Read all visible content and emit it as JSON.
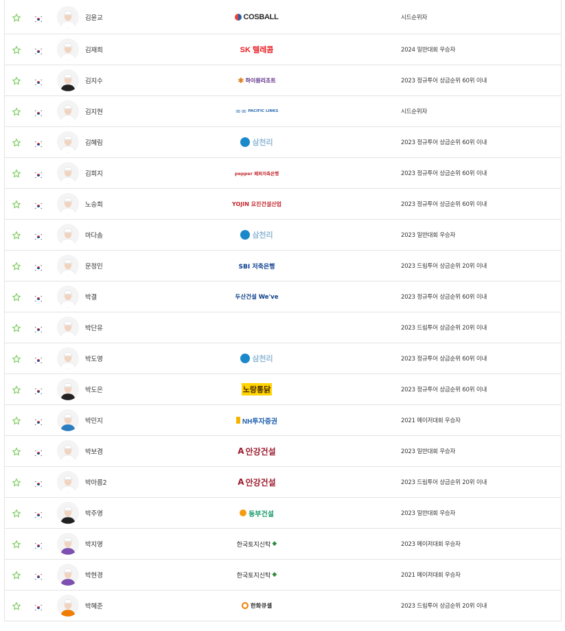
{
  "colors": {
    "star_outline": "#7acb5b",
    "row_divider": "#e3e3e3",
    "flag_red": "#cd2e3a",
    "flag_blue": "#0047a0"
  },
  "players": [
    {
      "name": "김윤교",
      "sponsor": "COSBALL",
      "sponsor_style": "cosball",
      "qualification": "시드순위자"
    },
    {
      "name": "김재희",
      "sponsor": "SK 텔레콤",
      "sponsor_style": "sk",
      "qualification": "2024 일반대회 우승자"
    },
    {
      "name": "김지수",
      "sponsor": "하이원리조트",
      "sponsor_style": "high1",
      "qualification": "2023 정규투어 상금순위 60위 이내"
    },
    {
      "name": "김지현",
      "sponsor": "PACIFIC LINKS",
      "sponsor_style": "pacific",
      "qualification": "시드순위자"
    },
    {
      "name": "김혜림",
      "sponsor": "삼천리",
      "sponsor_style": "samchully",
      "qualification": "2023 정규투어 상금순위 60위 이내"
    },
    {
      "name": "김희지",
      "sponsor": "pepper 페퍼저축은행",
      "sponsor_style": "pepper",
      "qualification": "2023 정규투어 상금순위 60위 이내"
    },
    {
      "name": "노승희",
      "sponsor": "YOJIN 요진건설산업",
      "sponsor_style": "yojin",
      "qualification": "2023 정규투어 상금순위 60위 이내"
    },
    {
      "name": "마다솜",
      "sponsor": "삼천리",
      "sponsor_style": "samchully",
      "qualification": "2023 일반대회 우승자"
    },
    {
      "name": "문정민",
      "sponsor": "SBI 저축은행",
      "sponsor_style": "sbi",
      "qualification": "2023 드림투어 상금순위 20위 이내"
    },
    {
      "name": "박결",
      "sponsor": "두산건설 We've",
      "sponsor_style": "doosan",
      "qualification": "2023 정규투어 상금순위 60위 이내"
    },
    {
      "name": "박단유",
      "sponsor": "",
      "sponsor_style": "none",
      "qualification": "2023 드림투어 상금순위 20위 이내"
    },
    {
      "name": "박도영",
      "sponsor": "삼천리",
      "sponsor_style": "samchully",
      "qualification": "2023 정규투어 상금순위 60위 이내"
    },
    {
      "name": "박도은",
      "sponsor": "노랑통닭",
      "sponsor_style": "norang",
      "qualification": "2023 정규투어 상금순위 60위 이내"
    },
    {
      "name": "박민지",
      "sponsor": "NH투자증권",
      "sponsor_style": "nh",
      "qualification": "2021 메이저대회 우승자"
    },
    {
      "name": "박보겸",
      "sponsor": "안강건설",
      "sponsor_style": "angang",
      "qualification": "2023 일반대회 우승자"
    },
    {
      "name": "박아름2",
      "sponsor": "안강건설",
      "sponsor_style": "angang",
      "qualification": "2023 드림투어 상금순위 20위 이내"
    },
    {
      "name": "박주영",
      "sponsor": "동부건설",
      "sponsor_style": "dongbu",
      "qualification": "2023 일반대회 우승자"
    },
    {
      "name": "박지영",
      "sponsor": "한국토지신탁",
      "sponsor_style": "koreit",
      "qualification": "2023 메이저대회 우승자"
    },
    {
      "name": "박현경",
      "sponsor": "한국토지신탁",
      "sponsor_style": "koreit",
      "qualification": "2021 메이저대회 우승자"
    },
    {
      "name": "박혜준",
      "sponsor": "한화큐셀",
      "sponsor_style": "hanwha",
      "qualification": "2023 드림투어 상금순위 20위 이내"
    }
  ]
}
